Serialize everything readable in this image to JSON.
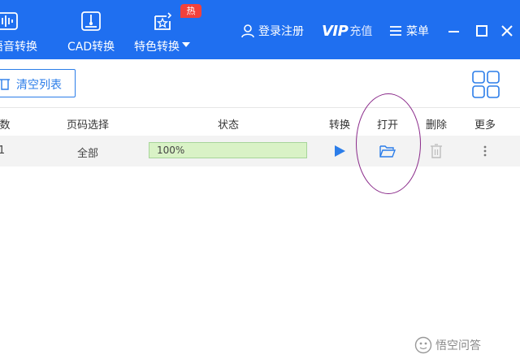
{
  "toolbar": {
    "tools": [
      {
        "label": "语音转换",
        "icon": "audio-wave-icon"
      },
      {
        "label": "CAD转换",
        "icon": "cad-icon"
      },
      {
        "label": "特色转换",
        "icon": "star-box-icon",
        "badge": "热"
      }
    ],
    "login_label": "登录注册",
    "vip_label": "VIP",
    "recharge_label": "充值",
    "menu_label": "菜单"
  },
  "actions": {
    "clear_list_label": "清空列表"
  },
  "table": {
    "headers": {
      "pages": "数",
      "page_select": "页码选择",
      "status": "状态",
      "convert": "转换",
      "open": "打开",
      "delete": "删除",
      "more": "更多"
    },
    "rows": [
      {
        "pages": "1",
        "page_select": "全部",
        "progress_text": "100%",
        "progress": 1.0
      }
    ]
  },
  "watermark": {
    "text": "悟空问答"
  },
  "colors": {
    "brand": "#1f6ff0",
    "accent": "#2b7de9",
    "badge": "#f2413b",
    "progress_fill": "#d9f2c6",
    "annotation": "#8a2a8a"
  }
}
